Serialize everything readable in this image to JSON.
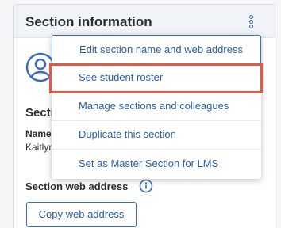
{
  "card": {
    "title": "Section information",
    "section_heading": "Secti",
    "name_label": "Name",
    "name_value": "Kaitlyn",
    "web_heading": "Section web address",
    "copy_button": "Copy web address"
  },
  "menu": {
    "items": [
      {
        "label": "Edit section name and web address"
      },
      {
        "label": "See student roster"
      },
      {
        "label": "Manage sections and colleagues"
      },
      {
        "label": "Duplicate this section"
      },
      {
        "label": "Set as Master Section for LMS"
      }
    ],
    "highlighted_index": 1
  },
  "colors": {
    "accent": "#2d5fa8",
    "highlight": "#e05a45",
    "header_bg": "#f0f3f7"
  },
  "icons": {
    "kebab": "more-vertical-icon",
    "avatar": "user-avatar-icon",
    "info": "info-icon"
  }
}
